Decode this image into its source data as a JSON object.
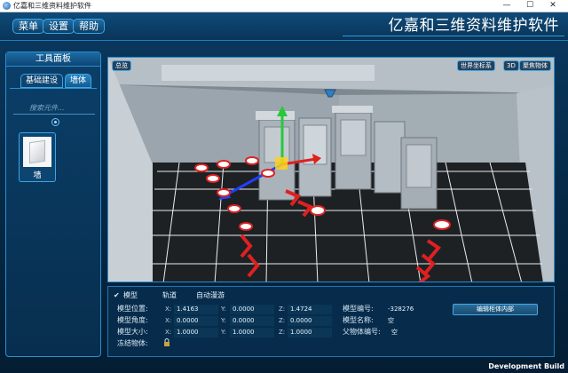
{
  "window": {
    "title": "亿嘉和三维资料维护软件",
    "icon": "app-icon",
    "controls": [
      "—",
      "☐",
      "✕"
    ]
  },
  "header": {
    "menu": [
      "菜单",
      "设置",
      "帮助"
    ],
    "app_title": "亿嘉和三维资料维护软件"
  },
  "toolpanel": {
    "title": "工具面板",
    "tabs": [
      "基础建设",
      "墙体"
    ],
    "active_tab": 1,
    "search_placeholder": "搜索元件...",
    "items": [
      {
        "label": "墙",
        "icon": "wall-icon"
      }
    ]
  },
  "viewport": {
    "overview_button": "总览",
    "coord_button": "世界坐标系",
    "view_button": "3D",
    "focus_button": "聚焦物体"
  },
  "properties": {
    "tabs": [
      "模型",
      "轨道",
      "自动漫游"
    ],
    "checked_tab": "模型",
    "position": {
      "label": "模型位置:",
      "x": "1.4163",
      "y": "0.0000",
      "z": "1.4724"
    },
    "rotation": {
      "label": "模型角度:",
      "x": "0.0000",
      "y": "0.0000",
      "z": "0.0000"
    },
    "scale": {
      "label": "模型大小:",
      "x": "1.0000",
      "y": "1.0000",
      "z": "1.0000"
    },
    "freeze_label": "冻结物体:",
    "axis_labels": [
      "X:",
      "Y:",
      "Z:"
    ],
    "model_id_label": "模型编号:",
    "model_id": "-328276",
    "model_name_label": "模型名称:",
    "model_name": "空",
    "parent_id_label": "父物体编号:",
    "parent_id": "空",
    "edit_button": "编辑柜体内部"
  },
  "footer": {
    "build": "Development Build"
  },
  "colors": {
    "accent": "#2a8fd0",
    "panel": "#0b3f69",
    "floor": "#1e2124",
    "gizmo_x": "#e02020",
    "gizmo_y": "#27c83a",
    "gizmo_z": "#2040ff"
  }
}
